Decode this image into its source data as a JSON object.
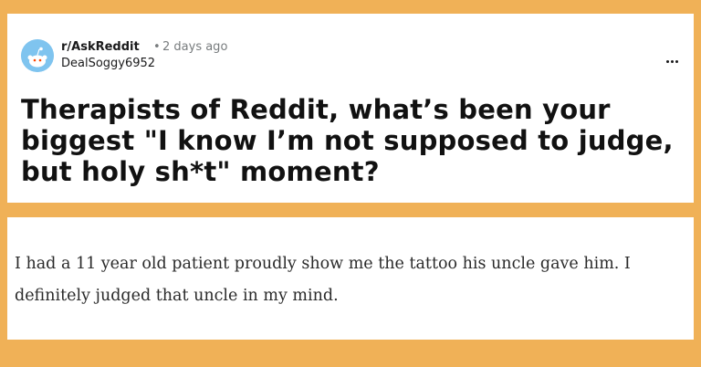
{
  "post": {
    "subreddit": "r/AskReddit",
    "separator": "•",
    "time_ago": "2 days ago",
    "username": "DealSoggy6952",
    "title": "Therapists of Reddit, what’s been your biggest \"I know I’m not supposed to judge, but holy sh*t\" moment?",
    "avatar_icon": "reddit-snoo-icon",
    "more_icon": "ellipsis-icon"
  },
  "comment": {
    "text": "I had a 11 year old patient proudly show me the tattoo his uncle gave him. I definitely judged that uncle in my mind."
  },
  "colors": {
    "background": "#f0b157",
    "card": "#ffffff",
    "avatar": "#7fc4ef",
    "meta_text": "#787c7e"
  }
}
